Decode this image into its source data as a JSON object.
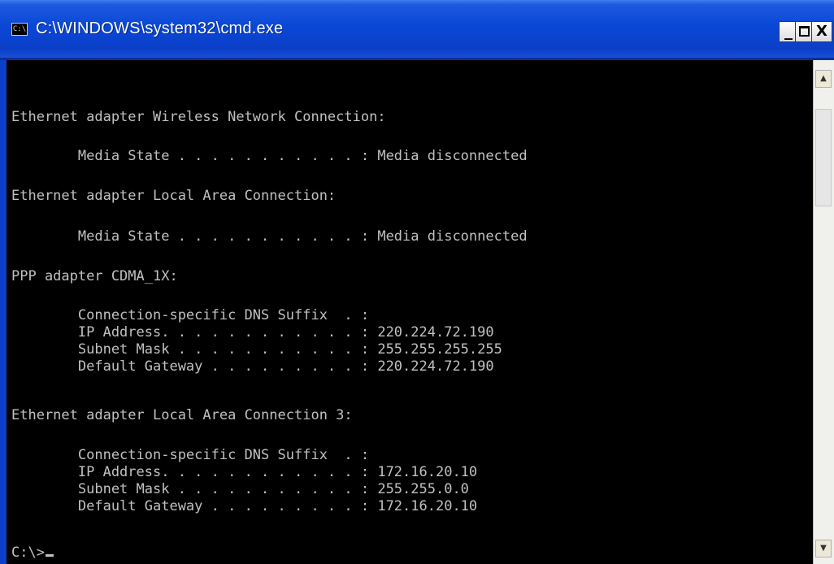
{
  "window": {
    "title": "C:\\WINDOWS\\system32\\cmd.exe",
    "icon": "cmd-icon",
    "icon_text": "C:\\",
    "controls": {
      "minimize": "_",
      "maximize": "maximize-icon",
      "close": "X"
    }
  },
  "console": {
    "lines": [
      "Ethernet adapter Wireless Network Connection:",
      "        Media State . . . . . . . . . . . : Media disconnected",
      "Ethernet adapter Local Area Connection:",
      "        Media State . . . . . . . . . . . : Media disconnected",
      "PPP adapter CDMA_1X:",
      "        Connection-specific DNS Suffix  . :",
      "        IP Address. . . . . . . . . . . . : 220.224.72.190",
      "        Subnet Mask . . . . . . . . . . . : 255.255.255.255",
      "        Default Gateway . . . . . . . . . : 220.224.72.190",
      "Ethernet adapter Local Area Connection 3:",
      "        Connection-specific DNS Suffix  . :",
      "        IP Address. . . . . . . . . . . . : 172.16.20.10",
      "        Subnet Mask . . . . . . . . . . . : 255.255.0.0",
      "        Default Gateway . . . . . . . . . : 172.16.20.10"
    ],
    "prompt": "C:\\>"
  },
  "colors": {
    "titlebar": "#0a47d6",
    "console_bg": "#000000",
    "console_text": "#c0c0c0"
  },
  "scrollbar": {
    "up_icon": "scroll-up-arrow-icon",
    "down_icon": "scroll-down-arrow-icon"
  }
}
